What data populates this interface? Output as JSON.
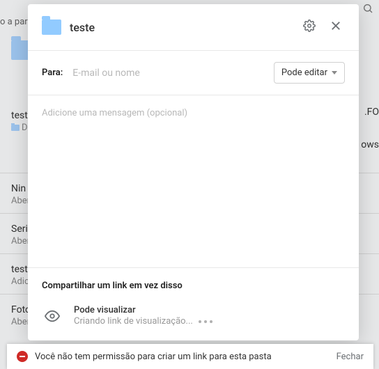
{
  "background": {
    "topleft_text": "o a parti",
    "folder_title": "test",
    "folder_sub": "Dro",
    "right_text_1": ".FO",
    "right_text_2": "ows",
    "items": [
      {
        "title": "Nin",
        "sub": "Aber"
      },
      {
        "title": "Seri",
        "sub": "Aber"
      },
      {
        "title": "test",
        "sub": "Adic"
      },
      {
        "title": "Foto",
        "sub": "Aber"
      }
    ]
  },
  "modal": {
    "folder_name": "teste",
    "to_label": "Para:",
    "to_placeholder": "E-mail ou nome",
    "permission_label": "Pode editar",
    "message_placeholder": "Adicione uma mensagem (opcional)",
    "link_section_title": "Compartilhar um link em vez disso",
    "view_title": "Pode visualizar",
    "view_status": "Criando link de visualização..."
  },
  "toast": {
    "message": "Você não tem permissão para criar um link para esta pasta",
    "close": "Fechar"
  }
}
